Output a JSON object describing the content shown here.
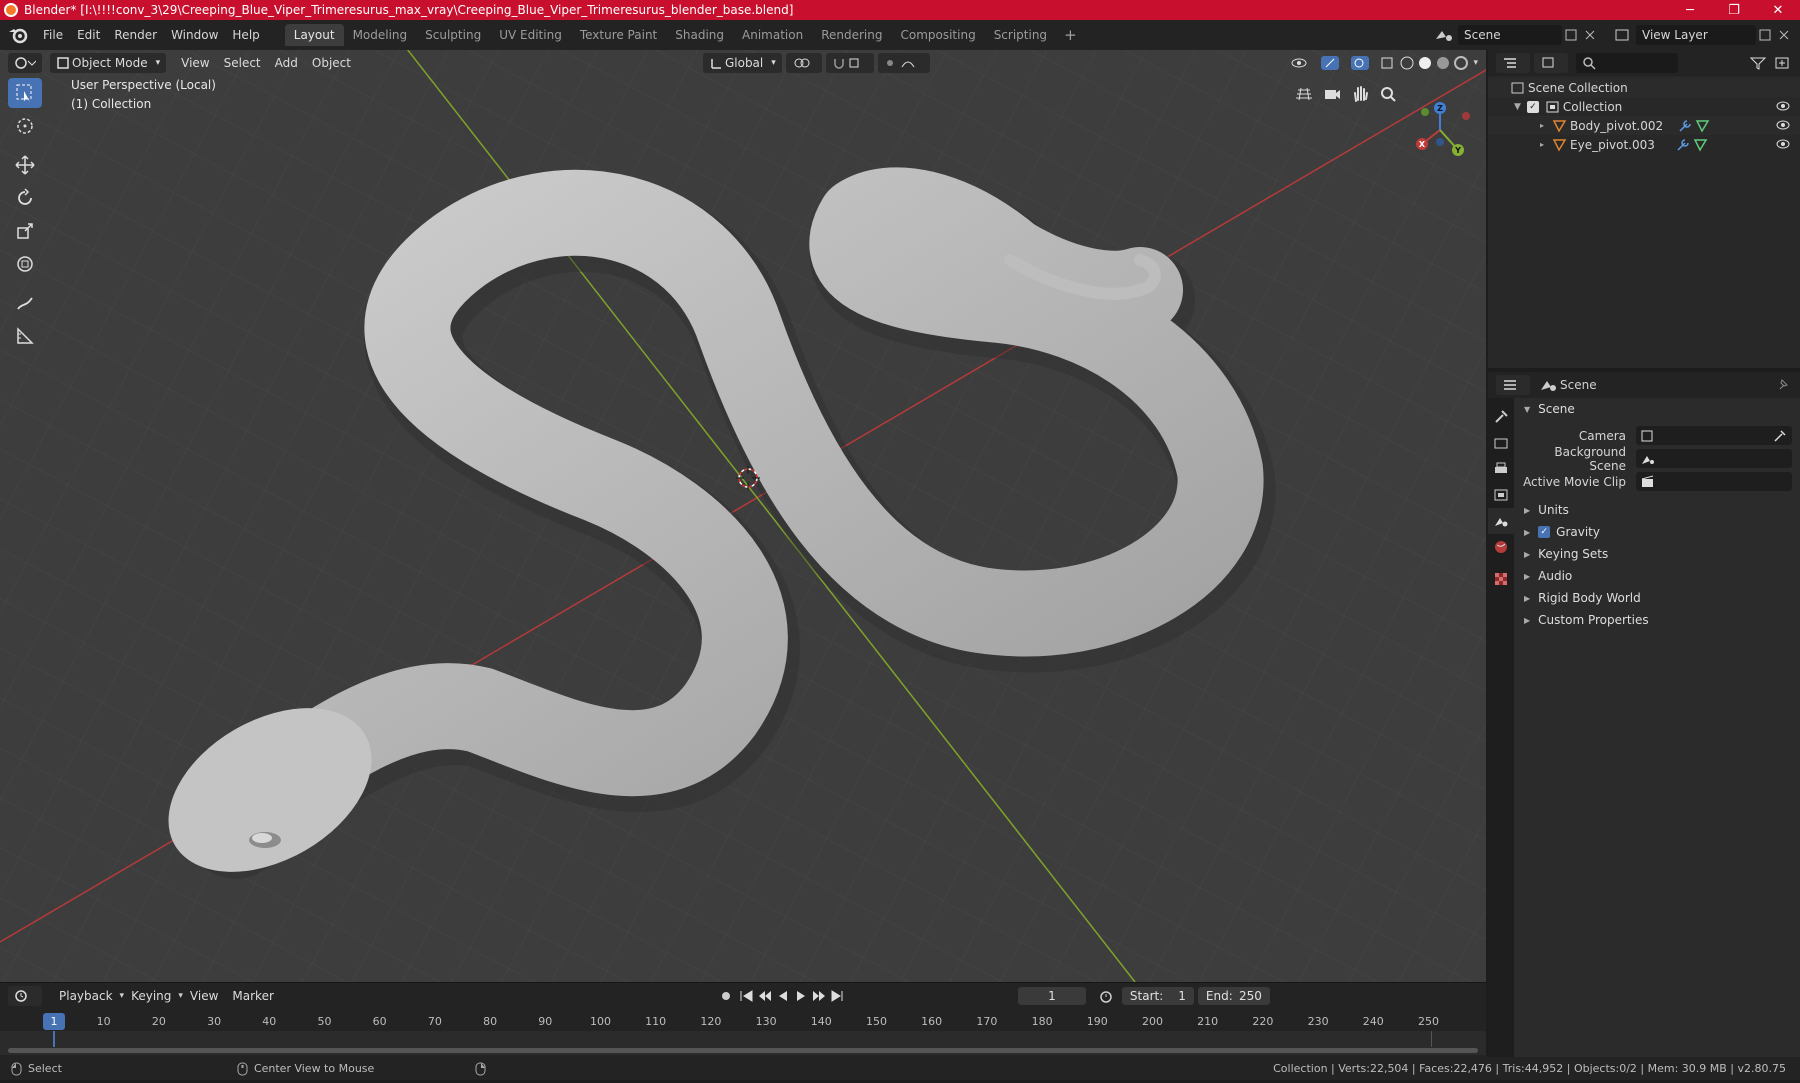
{
  "window": {
    "title": "Blender* [I:\\!!!!conv_3\\29\\Creeping_Blue_Viper_Trimeresurus_max_vray\\Creeping_Blue_Viper_Trimeresurus_blender_base.blend]",
    "minimize": "─",
    "maximize": "❐",
    "close": "✕"
  },
  "menu": [
    "File",
    "Edit",
    "Render",
    "Window",
    "Help"
  ],
  "workspaces": [
    "Layout",
    "Modeling",
    "Sculpting",
    "UV Editing",
    "Texture Paint",
    "Shading",
    "Animation",
    "Rendering",
    "Compositing",
    "Scripting"
  ],
  "active_workspace": "Layout",
  "add_workspace": "+",
  "scene_name": "Scene",
  "view_layer": "View Layer",
  "viewport": {
    "mode": "Object Mode",
    "menus": [
      "View",
      "Select",
      "Add",
      "Object"
    ],
    "transform_orientation": "Global",
    "info_line1": "User Perspective (Local)",
    "info_line2": "(1) Collection",
    "axis_x": "X",
    "axis_y": "Y",
    "axis_z": "Z"
  },
  "timeline": {
    "menus": [
      "Playback",
      "Keying",
      "View",
      "Marker"
    ],
    "current_frame": "1",
    "start_label": "Start:",
    "start": "1",
    "end_label": "End:",
    "end": "250",
    "ruler": [
      "1",
      "10",
      "20",
      "30",
      "40",
      "50",
      "60",
      "70",
      "80",
      "90",
      "100",
      "110",
      "120",
      "130",
      "140",
      "150",
      "160",
      "170",
      "180",
      "190",
      "200",
      "210",
      "220",
      "230",
      "240",
      "250"
    ]
  },
  "statusbar": {
    "select": "Select",
    "center_view": "Center View to Mouse",
    "stats": "Collection | Verts:22,504 | Faces:22,476 | Tris:44,952 | Objects:0/2 | Mem: 30.9 MB | v2.80.75"
  },
  "outliner": {
    "scene_collection": "Scene Collection",
    "collection": "Collection",
    "objects": [
      "Body_pivot.002",
      "Eye_pivot.003"
    ]
  },
  "properties": {
    "context": "Scene",
    "panel_scene": "Scene",
    "camera_label": "Camera",
    "background_scene_label": "Background Scene",
    "active_movie_clip_label": "Active Movie Clip",
    "panels": [
      "Units",
      "Gravity",
      "Keying Sets",
      "Audio",
      "Rigid Body World",
      "Custom Properties"
    ],
    "gravity_checked": true
  },
  "colors": {
    "titlebar": "#c8102e",
    "accent": "#4772b3",
    "x_axis": "#b53a3a",
    "y_axis": "#7da32a"
  }
}
